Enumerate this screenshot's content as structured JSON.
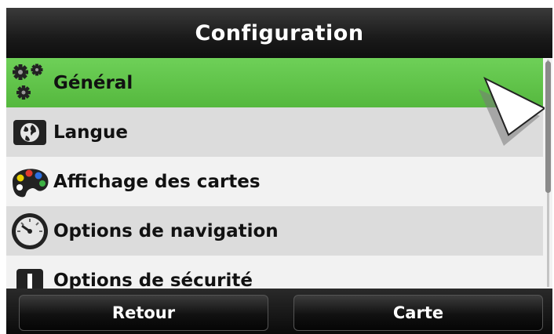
{
  "header": {
    "title": "Configuration"
  },
  "menu": {
    "items": [
      {
        "label": "Général",
        "icon": "gears-icon",
        "selected": true
      },
      {
        "label": "Langue",
        "icon": "globe-icon",
        "selected": false
      },
      {
        "label": "Affichage des cartes",
        "icon": "palette-icon",
        "selected": false
      },
      {
        "label": "Options de navigation",
        "icon": "gauge-icon",
        "selected": false
      },
      {
        "label": "Options de sécurité",
        "icon": "warning-icon",
        "selected": false
      }
    ]
  },
  "footer": {
    "back_label": "Retour",
    "map_label": "Carte"
  },
  "colors": {
    "selected": "#5cc043",
    "header": "#1a1a1a",
    "row_light": "#f2f2f2",
    "row_dark": "#dcdcdc"
  }
}
